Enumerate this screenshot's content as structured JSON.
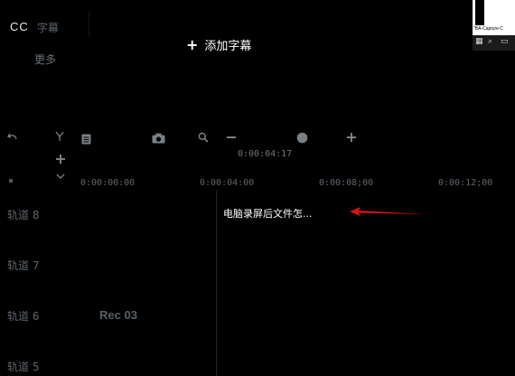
{
  "panel": {
    "cc_label": "CC",
    "subtitle_tab": "字幕",
    "more_tab": "更多",
    "add_subtitle_label": "添加字幕"
  },
  "system": {
    "caption": "\"BA-Capture C"
  },
  "toolbar": {
    "icons": [
      "undo-icon",
      "split-icon",
      "subtitle-icon",
      "snapshot-icon",
      "search-icon",
      "zoom-out-icon",
      "zoom-slider-knob",
      "zoom-in-icon",
      "add-track-icon",
      "collapse-icon"
    ],
    "time_readout": "0:00:04:17"
  },
  "ruler": {
    "ticks": [
      "0:00:00:00",
      "0:00:04:00",
      "0:00:08;00",
      "0:00:12;00"
    ]
  },
  "tracks": [
    {
      "label": "轨道 8"
    },
    {
      "label": "轨道 7"
    },
    {
      "label": "轨道 6"
    },
    {
      "label": "轨道 5"
    }
  ],
  "clip": {
    "title": "电脑录屏后文件怎..."
  },
  "media": {
    "rec_label": "Rec 03"
  },
  "colors": {
    "background": "#000000",
    "arrow": "#e01010",
    "playhead": "#1a2438"
  }
}
